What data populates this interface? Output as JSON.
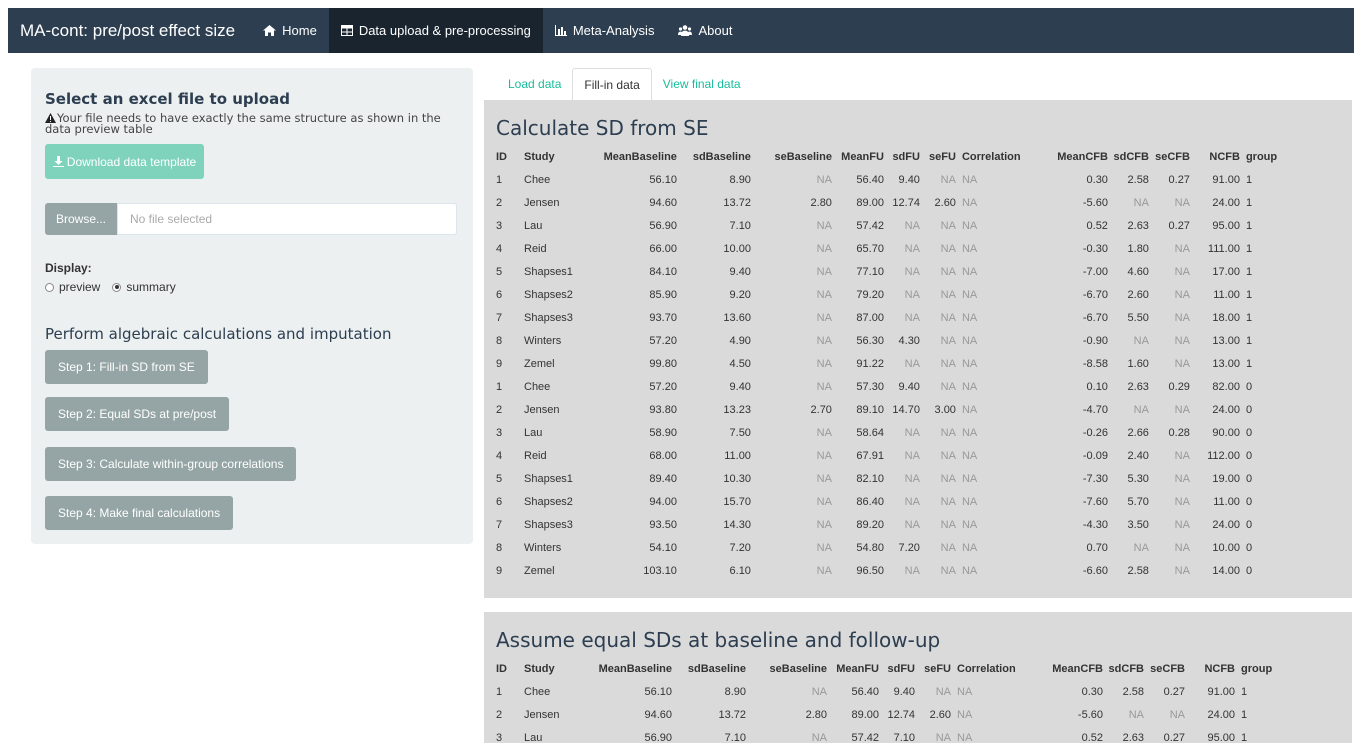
{
  "navbar": {
    "brand": "MA-cont: pre/post effect size",
    "items": [
      {
        "label": "Home",
        "icon": "home-icon",
        "active": false
      },
      {
        "label": "Data upload & pre-processing",
        "icon": "table-icon",
        "active": true
      },
      {
        "label": "Meta-Analysis",
        "icon": "bar-chart-icon",
        "active": false
      },
      {
        "label": "About",
        "icon": "users-icon",
        "active": false
      }
    ]
  },
  "sidebar": {
    "title": "Select an excel file to upload",
    "warning": "Your file needs to have exactly the same structure as shown in the data preview table",
    "download_label": "Download data template",
    "browse_label": "Browse...",
    "file_placeholder": "No file selected",
    "display_label": "Display:",
    "display_options": [
      "preview",
      "summary"
    ],
    "display_selected": "summary",
    "calc_title": "Perform algebraic calculations and imputation",
    "steps": [
      "Step 1: Fill-in SD from SE",
      "Step 2: Equal SDs at pre/post",
      "Step 3: Calculate within-group correlations",
      "Step 4: Make final calculations"
    ]
  },
  "tabs": [
    {
      "label": "Load data",
      "active": false
    },
    {
      "label": "Fill-in data",
      "active": true
    },
    {
      "label": "View final data",
      "active": false
    }
  ],
  "colors": {
    "navbar": "#2c3e50",
    "navbar_active": "#1a242f",
    "accent": "#18bc9c",
    "button": "#95a5a6",
    "download": "#7fd3bd",
    "panel": "#dadada"
  },
  "columns": [
    "ID",
    "Study",
    "MeanBaseline",
    "sdBaseline",
    "seBaseline",
    "MeanFU",
    "sdFU",
    "seFU",
    "Correlation",
    "MeanCFB",
    "sdCFB",
    "seCFB",
    "NCFB",
    "group"
  ],
  "tables": [
    {
      "title": "Calculate SD from SE",
      "rows": [
        [
          "1",
          "Chee",
          "56.10",
          "8.90",
          "NA",
          "56.40",
          "9.40",
          "NA",
          "NA",
          "0.30",
          "2.58",
          "0.27",
          "91.00",
          "1"
        ],
        [
          "2",
          "Jensen",
          "94.60",
          "13.72",
          "2.80",
          "89.00",
          "12.74",
          "2.60",
          "NA",
          "-5.60",
          "NA",
          "NA",
          "24.00",
          "1"
        ],
        [
          "3",
          "Lau",
          "56.90",
          "7.10",
          "NA",
          "57.42",
          "NA",
          "NA",
          "NA",
          "0.52",
          "2.63",
          "0.27",
          "95.00",
          "1"
        ],
        [
          "4",
          "Reid",
          "66.00",
          "10.00",
          "NA",
          "65.70",
          "NA",
          "NA",
          "NA",
          "-0.30",
          "1.80",
          "NA",
          "111.00",
          "1"
        ],
        [
          "5",
          "Shapses1",
          "84.10",
          "9.40",
          "NA",
          "77.10",
          "NA",
          "NA",
          "NA",
          "-7.00",
          "4.60",
          "NA",
          "17.00",
          "1"
        ],
        [
          "6",
          "Shapses2",
          "85.90",
          "9.20",
          "NA",
          "79.20",
          "NA",
          "NA",
          "NA",
          "-6.70",
          "2.60",
          "NA",
          "11.00",
          "1"
        ],
        [
          "7",
          "Shapses3",
          "93.70",
          "13.60",
          "NA",
          "87.00",
          "NA",
          "NA",
          "NA",
          "-6.70",
          "5.50",
          "NA",
          "18.00",
          "1"
        ],
        [
          "8",
          "Winters",
          "57.20",
          "4.90",
          "NA",
          "56.30",
          "4.30",
          "NA",
          "NA",
          "-0.90",
          "NA",
          "NA",
          "13.00",
          "1"
        ],
        [
          "9",
          "Zemel",
          "99.80",
          "4.50",
          "NA",
          "91.22",
          "NA",
          "NA",
          "NA",
          "-8.58",
          "1.60",
          "NA",
          "13.00",
          "1"
        ],
        [
          "1",
          "Chee",
          "57.20",
          "9.40",
          "NA",
          "57.30",
          "9.40",
          "NA",
          "NA",
          "0.10",
          "2.63",
          "0.29",
          "82.00",
          "0"
        ],
        [
          "2",
          "Jensen",
          "93.80",
          "13.23",
          "2.70",
          "89.10",
          "14.70",
          "3.00",
          "NA",
          "-4.70",
          "NA",
          "NA",
          "24.00",
          "0"
        ],
        [
          "3",
          "Lau",
          "58.90",
          "7.50",
          "NA",
          "58.64",
          "NA",
          "NA",
          "NA",
          "-0.26",
          "2.66",
          "0.28",
          "90.00",
          "0"
        ],
        [
          "4",
          "Reid",
          "68.00",
          "11.00",
          "NA",
          "67.91",
          "NA",
          "NA",
          "NA",
          "-0.09",
          "2.40",
          "NA",
          "112.00",
          "0"
        ],
        [
          "5",
          "Shapses1",
          "89.40",
          "10.30",
          "NA",
          "82.10",
          "NA",
          "NA",
          "NA",
          "-7.30",
          "5.30",
          "NA",
          "19.00",
          "0"
        ],
        [
          "6",
          "Shapses2",
          "94.00",
          "15.70",
          "NA",
          "86.40",
          "NA",
          "NA",
          "NA",
          "-7.60",
          "5.70",
          "NA",
          "11.00",
          "0"
        ],
        [
          "7",
          "Shapses3",
          "93.50",
          "14.30",
          "NA",
          "89.20",
          "NA",
          "NA",
          "NA",
          "-4.30",
          "3.50",
          "NA",
          "24.00",
          "0"
        ],
        [
          "8",
          "Winters",
          "54.10",
          "7.20",
          "NA",
          "54.80",
          "7.20",
          "NA",
          "NA",
          "0.70",
          "NA",
          "NA",
          "10.00",
          "0"
        ],
        [
          "9",
          "Zemel",
          "103.10",
          "6.10",
          "NA",
          "96.50",
          "NA",
          "NA",
          "NA",
          "-6.60",
          "2.58",
          "NA",
          "14.00",
          "0"
        ]
      ]
    },
    {
      "title": "Assume equal SDs at baseline and follow-up",
      "rows": [
        [
          "1",
          "Chee",
          "56.10",
          "8.90",
          "NA",
          "56.40",
          "9.40",
          "NA",
          "NA",
          "0.30",
          "2.58",
          "0.27",
          "91.00",
          "1"
        ],
        [
          "2",
          "Jensen",
          "94.60",
          "13.72",
          "2.80",
          "89.00",
          "12.74",
          "2.60",
          "NA",
          "-5.60",
          "NA",
          "NA",
          "24.00",
          "1"
        ],
        [
          "3",
          "Lau",
          "56.90",
          "7.10",
          "NA",
          "57.42",
          "7.10",
          "NA",
          "NA",
          "0.52",
          "2.63",
          "0.27",
          "95.00",
          "1"
        ]
      ]
    }
  ]
}
